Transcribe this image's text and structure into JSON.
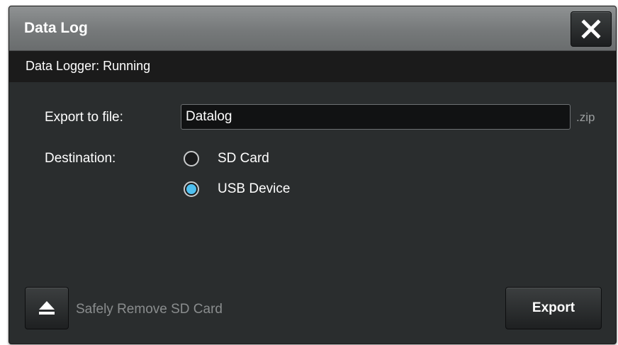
{
  "dialog": {
    "title": "Data Log",
    "close_icon": "close-icon"
  },
  "status": {
    "text": "Data Logger: Running"
  },
  "export": {
    "label": "Export to file:",
    "filename": "Datalog",
    "extension": ".zip"
  },
  "destination": {
    "label": "Destination:",
    "options": [
      {
        "label": "SD Card",
        "selected": false
      },
      {
        "label": "USB Device",
        "selected": true
      }
    ]
  },
  "footer": {
    "eject_icon": "eject-icon",
    "eject_label": "Safely Remove SD Card",
    "export_label": "Export"
  },
  "colors": {
    "radio_selected": "#4fc0f0",
    "dialog_bg": "#2a2d2e",
    "titlebar": "#76797a"
  }
}
